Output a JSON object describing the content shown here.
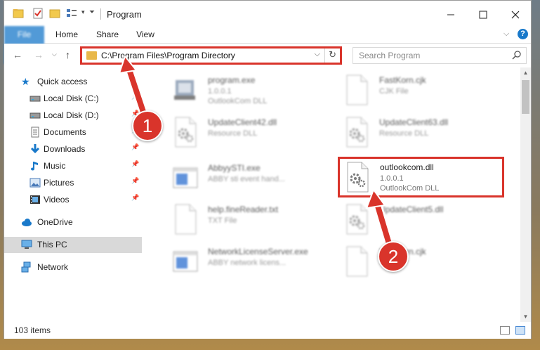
{
  "window": {
    "title": "Program"
  },
  "ribbon": {
    "file": "File",
    "home": "Home",
    "share": "Share",
    "view": "View"
  },
  "address": {
    "path": "C:\\Program Files\\Program Directory"
  },
  "search": {
    "placeholder": "Search Program"
  },
  "nav": {
    "quick_access": "Quick access",
    "items": [
      {
        "label": "Local Disk (C:)",
        "icon": "drive-icon",
        "pinned": true
      },
      {
        "label": "Local Disk (D:)",
        "icon": "drive-icon",
        "pinned": true
      },
      {
        "label": "Documents",
        "icon": "documents-icon",
        "pinned": true
      },
      {
        "label": "Downloads",
        "icon": "downloads-icon",
        "pinned": true
      },
      {
        "label": "Music",
        "icon": "music-icon",
        "pinned": true
      },
      {
        "label": "Pictures",
        "icon": "pictures-icon",
        "pinned": true
      },
      {
        "label": "Videos",
        "icon": "videos-icon",
        "pinned": true
      }
    ],
    "onedrive": "OneDrive",
    "this_pc": "This PC",
    "network": "Network"
  },
  "files": [
    {
      "name": "program.exe",
      "line2": "1.0.0.1",
      "line3": "OutlookCom DLL",
      "icon": "exe-icon"
    },
    {
      "name": "FastKorn.cjk",
      "line2": "CJK File",
      "line3": "",
      "icon": "blank-file-icon"
    },
    {
      "name": "UpdateClient42.dll",
      "line2": "Resource DLL",
      "line3": "",
      "icon": "dll-icon"
    },
    {
      "name": "UpdateClient63.dll",
      "line2": "Resource DLL",
      "line3": "",
      "icon": "dll-icon"
    },
    {
      "name": "AbbyySTI.exe",
      "line2": "ABBY sti event hand...",
      "line3": "",
      "icon": "window-icon"
    },
    {
      "name": "outlookcom.dll",
      "line2": "1.0.0.1",
      "line3": "OutlookCom DLL",
      "icon": "dll-icon"
    },
    {
      "name": "help.fineReader.txt",
      "line2": "TXT File",
      "line3": "",
      "icon": "blank-file-icon"
    },
    {
      "name": "UpdateClient5.dll",
      "line2": "",
      "line3": "",
      "icon": "dll-icon"
    },
    {
      "name": "NetworkLicenseServer.exe",
      "line2": "ABBY network licens...",
      "line3": "",
      "icon": "window-icon"
    },
    {
      "name": "FastKorn.cjk",
      "line2": "",
      "line3": "",
      "icon": "blank-file-icon"
    }
  ],
  "status": {
    "count": "103 items"
  },
  "callouts": {
    "one": "1",
    "two": "2"
  },
  "colors": {
    "accent": "#1979ca",
    "highlight": "#d9342b"
  }
}
